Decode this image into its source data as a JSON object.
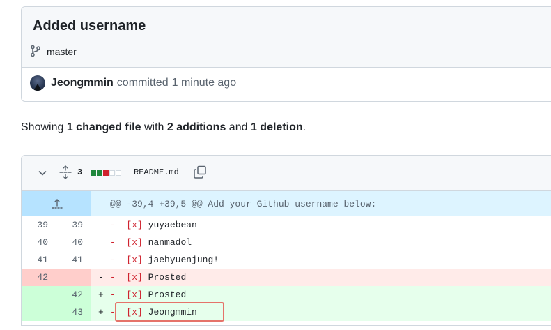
{
  "commit": {
    "title": "Added username",
    "branch": "master",
    "author": "Jeongmmin",
    "action": "committed",
    "time": "1 minute ago"
  },
  "summary": {
    "prefix": "Showing",
    "changed": "1 changed file",
    "with": "with",
    "additions": "2 additions",
    "and": "and",
    "deletions": "1 deletion",
    "suffix": "."
  },
  "file": {
    "change_count": "3",
    "name": "README.md",
    "bars": [
      "add",
      "add",
      "del",
      "neu",
      "neu"
    ]
  },
  "hunk": {
    "header": "@@ -39,4 +39,5 @@ Add your Github username below:"
  },
  "rows": [
    {
      "type": "ctx",
      "old": "39",
      "new": "39",
      "marker": "",
      "dash": "-",
      "box": "[x]",
      "name": "yuyaebean"
    },
    {
      "type": "ctx",
      "old": "40",
      "new": "40",
      "marker": "",
      "dash": "-",
      "box": "[x]",
      "name": "nanmadol"
    },
    {
      "type": "ctx",
      "old": "41",
      "new": "41",
      "marker": "",
      "dash": "-",
      "box": "[x]",
      "name": "jaehyuenjung!"
    },
    {
      "type": "del",
      "old": "42",
      "new": "",
      "marker": "-",
      "dash": "-",
      "box": "[x]",
      "name": "Prosted"
    },
    {
      "type": "add",
      "old": "",
      "new": "42",
      "marker": "+",
      "dash": "-",
      "box": "[x]",
      "name": "Prosted"
    },
    {
      "type": "add",
      "old": "",
      "new": "43",
      "marker": "+",
      "dash": "-",
      "box": "[x]",
      "name": "Jeongmmin"
    }
  ],
  "colors": {
    "addition": "#1f883d",
    "deletion": "#cf222e",
    "annotation": "#e5736a"
  }
}
